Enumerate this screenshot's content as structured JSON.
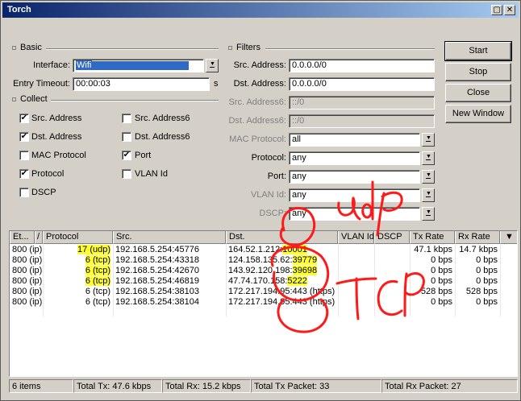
{
  "window": {
    "title": "Torch"
  },
  "basic": {
    "group_title": "Basic",
    "interface_label": "Interface:",
    "interface_value": "Wifi",
    "timeout_label": "Entry Timeout:",
    "timeout_value": "00:00:03",
    "timeout_unit": "s"
  },
  "collect": {
    "group_title": "Collect",
    "items": [
      {
        "label": "Src. Address",
        "checked": true
      },
      {
        "label": "Dst. Address",
        "checked": true
      },
      {
        "label": "MAC Protocol",
        "checked": false
      },
      {
        "label": "Protocol",
        "checked": true
      },
      {
        "label": "DSCP",
        "checked": false
      },
      {
        "label": "Src. Address6",
        "checked": false
      },
      {
        "label": "Dst. Address6",
        "checked": false
      },
      {
        "label": "Port",
        "checked": true
      },
      {
        "label": "VLAN Id",
        "checked": false
      }
    ],
    "check_mark": "✔"
  },
  "filters": {
    "group_title": "Filters",
    "src_label": "Src. Address:",
    "src_value": "0.0.0.0/0",
    "dst_label": "Dst. Address:",
    "dst_value": "0.0.0.0/0",
    "src6_label": "Src. Address6:",
    "src6_value": "::/0",
    "dst6_label": "Dst. Address6:",
    "dst6_value": "::/0",
    "mac_label": "MAC Protocol:",
    "mac_value": "all",
    "proto_label": "Protocol:",
    "proto_value": "any",
    "port_label": "Port:",
    "port_value": "any",
    "vlan_label": "VLAN Id:",
    "vlan_value": "any",
    "dscp_label": "DSCP:",
    "dscp_value": "any"
  },
  "buttons": {
    "start": "Start",
    "stop": "Stop",
    "close": "Close",
    "new_window": "New Window"
  },
  "table": {
    "headers": [
      "Et...",
      "/",
      "Protocol",
      "Src.",
      "Dst.",
      "VLAN Id",
      "DSCP",
      "Tx Rate",
      "Rx Rate"
    ],
    "rows": [
      {
        "eth": "800 (ip)",
        "proto_num": "17",
        "proto_name": "(udp)",
        "src": "192.168.5.254:45776",
        "dst_ip": "164.52.1.212:",
        "dst_port": "10001",
        "tx": "47.1 kbps",
        "rx": "14.7 kbps"
      },
      {
        "eth": "800 (ip)",
        "proto_num": "6",
        "proto_name": "(tcp)",
        "src": "192.168.5.254:43318",
        "dst_ip": "124.158.135.62:",
        "dst_port": "39779",
        "tx": "0 bps",
        "rx": "0 bps"
      },
      {
        "eth": "800 (ip)",
        "proto_num": "6",
        "proto_name": "(tcp)",
        "src": "192.168.5.254:42670",
        "dst_ip": "143.92.120.198:",
        "dst_port": "39698",
        "tx": "0 bps",
        "rx": "0 bps"
      },
      {
        "eth": "800 (ip)",
        "proto_num": "6",
        "proto_name": "(tcp)",
        "src": "192.168.5.254:46819",
        "dst_ip": "47.74.170.158:",
        "dst_port": "5222",
        "tx": "0 bps",
        "rx": "0 bps"
      },
      {
        "eth": "800 (ip)",
        "proto_num": "6",
        "proto_name": "(tcp)",
        "src": "192.168.5.254:38103",
        "dst_ip": "172.217.194.95:443 (https)",
        "dst_port": "",
        "tx": "528 bps",
        "rx": "528 bps"
      },
      {
        "eth": "800 (ip)",
        "proto_num": "6",
        "proto_name": "(tcp)",
        "src": "192.168.5.254:38104",
        "dst_ip": "172.217.194.95:443 (https)",
        "dst_port": "",
        "tx": "0 bps",
        "rx": "0 bps"
      }
    ]
  },
  "status": {
    "items": "6 items",
    "total_tx": "Total Tx: 47.6 kbps",
    "total_rx": "Total Rx: 15.2 kbps",
    "total_tx_packet": "Total Tx Packet: 33",
    "total_rx_packet": "Total Rx Packet: 27"
  },
  "annotations": {
    "udp_text": "udp",
    "tcp_text": "TCP",
    "ink_color": "#ff1a1a",
    "highlight_color": "#ffff33"
  }
}
